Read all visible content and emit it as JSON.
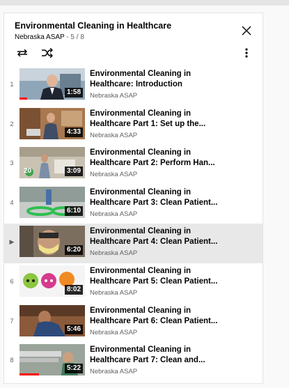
{
  "playlist": {
    "title": "Environmental Cleaning in Healthcare",
    "channel": "Nebraska ASAP",
    "position": "5 / 8",
    "separator": " - "
  },
  "icons": {
    "close": "close-icon",
    "loop": "loop-icon",
    "shuffle": "shuffle-icon",
    "more": "more-vert-icon"
  },
  "colors": {
    "progress": "#ff0000",
    "active_row": "#e8e8e8"
  },
  "items": [
    {
      "index": "1",
      "title1": "Environmental Cleaning in",
      "title2": "Healthcare: Introduction",
      "channel": "Nebraska ASAP",
      "duration": "1:58",
      "progress": 0.12,
      "active": false
    },
    {
      "index": "2",
      "title1": "Environmental Cleaning in",
      "title2": "Healthcare Part 1: Set up the...",
      "channel": "Nebraska ASAP",
      "duration": "4:33",
      "progress": 0,
      "active": false
    },
    {
      "index": "3",
      "title1": "Environmental Cleaning in",
      "title2": "Healthcare Part 2: Perform Han...",
      "channel": "Nebraska ASAP",
      "duration": "3:09",
      "progress": 0,
      "active": false
    },
    {
      "index": "4",
      "title1": "Environmental Cleaning in",
      "title2": "Healthcare Part 3: Clean Patient...",
      "channel": "Nebraska ASAP",
      "duration": "6:10",
      "progress": 0,
      "active": false
    },
    {
      "index": "▶",
      "title1": "Environmental Cleaning in",
      "title2": "Healthcare Part 4: Clean Patient...",
      "channel": "Nebraska ASAP",
      "duration": "6:20",
      "progress": 0,
      "active": true
    },
    {
      "index": "6",
      "title1": "Environmental Cleaning in",
      "title2": "Healthcare Part 5: Clean Patient...",
      "channel": "Nebraska ASAP",
      "duration": "8:02",
      "progress": 0,
      "active": false
    },
    {
      "index": "7",
      "title1": "Environmental Cleaning in",
      "title2": "Healthcare Part 6: Clean Patient...",
      "channel": "Nebraska ASAP",
      "duration": "5:46",
      "progress": 0,
      "active": false
    },
    {
      "index": "8",
      "title1": "Environmental Cleaning in",
      "title2": "Healthcare Part 7: Clean and...",
      "channel": "Nebraska ASAP",
      "duration": "5:22",
      "progress": 0.3,
      "active": false
    }
  ],
  "thumb3_badge": "20"
}
